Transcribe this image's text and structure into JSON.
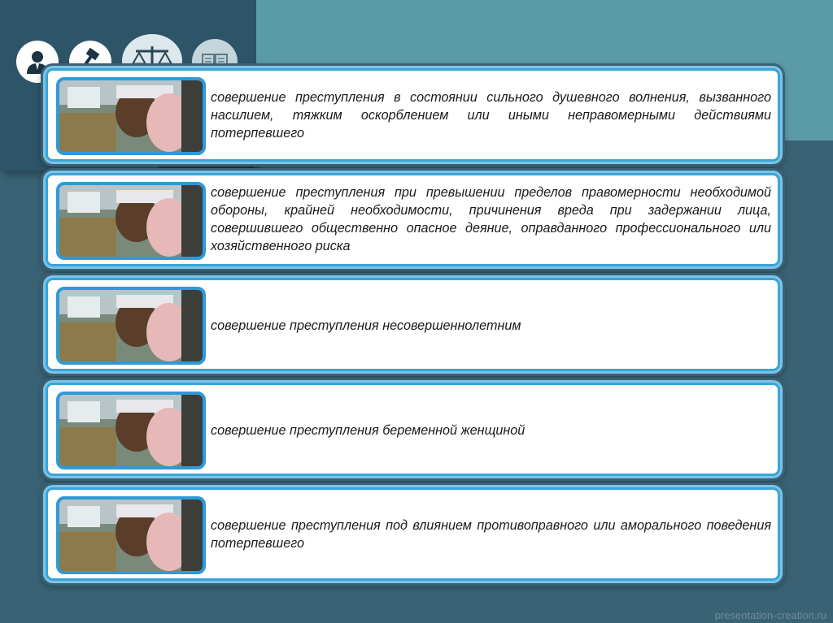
{
  "header_icons": [
    {
      "name": "person-icon"
    },
    {
      "name": "gavel-icon"
    },
    {
      "name": "scales-icon"
    },
    {
      "name": "book-icon"
    }
  ],
  "cards": [
    {
      "text": "совершение преступления в состоянии сильного душевного волнения, вызванного насилием, тяжким оскорблением или иными неправомерными действиями потерпевшего"
    },
    {
      "text": "совершение преступления при превышении пределов правомерности необходимой обороны, крайней необходимости, причинения вреда при задержании лица, совершившего общественно опасное деяние, оправданного профессионального или хозяйственного риска"
    },
    {
      "text": "совершение преступления несовершеннолетним"
    },
    {
      "text": "совершение преступления беременной женщиной"
    },
    {
      "text": "совершение преступления под влиянием противоправного или аморального поведения потерпевшего"
    }
  ],
  "watermark": "presentation-creation.ru",
  "colors": {
    "background": "#3a6275",
    "accent": "#3aa4d8",
    "panel": "#5b9ba7"
  }
}
